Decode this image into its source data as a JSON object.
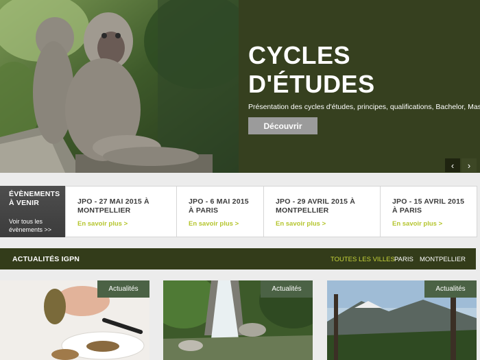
{
  "hero": {
    "title": "CYCLES\nD'ÉTUDES",
    "subtitle": "Présentation des cycles d'études, principes, qualifications, Bachelor, Master…",
    "button_label": "Découvrir",
    "prev_arrow": "‹",
    "next_arrow": "›"
  },
  "events": {
    "label": "ÉVÈNEMENTS\nÀ VENIR",
    "see_all": "Voir tous les\névènements >>",
    "items": [
      {
        "title": "JPO - 27 MAI 2015 À\nMONTPELLIER",
        "link": "En savoir plus >"
      },
      {
        "title": "JPO - 6 MAI 2015\nÀ PARIS",
        "link": "En savoir plus >"
      },
      {
        "title": "JPO - 29 AVRIL 2015 À\nMONTPELLIER",
        "link": "En savoir plus >"
      },
      {
        "title": "JPO - 15 AVRIL 2015\nÀ PARIS",
        "link": "En savoir plus >"
      }
    ]
  },
  "news": {
    "title": "ACTUALITÉS IGPN",
    "filters": [
      "TOUTES LES VILLES",
      "PARIS",
      "MONTPELLIER"
    ],
    "cards": [
      {
        "badge": "Actualités"
      },
      {
        "badge": "Actualités"
      },
      {
        "badge": "Actualités"
      }
    ]
  },
  "colors": {
    "hero_panel": "#36401f",
    "news_bar": "#333c1a",
    "accent_green": "#b5c52e",
    "badge": "#4b6245"
  }
}
